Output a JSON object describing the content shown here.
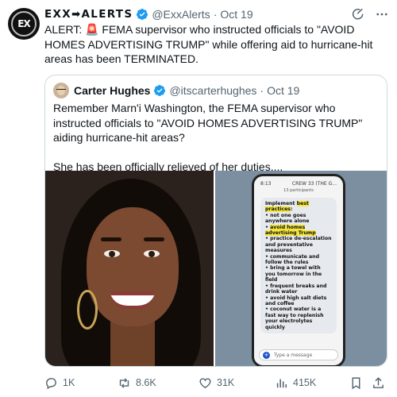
{
  "tweet": {
    "display_name": "EXX➡ALERTS",
    "handle": "@ExxAlerts",
    "separator": "·",
    "date": "Oct 19",
    "text": "ALERT: 🚨 FEMA supervisor who instructed officials to \"AVOID HOMES ADVERTISING TRUMP\" while offering aid to hurricane-hit areas has been TERMINATED.",
    "avatar_icon": "exx-logo",
    "icons": [
      "grok-icon",
      "more-icon"
    ]
  },
  "quote": {
    "display_name": "Carter Hughes",
    "handle": "@itscarterhughes",
    "separator": "·",
    "date": "Oct 19",
    "paragraph_1": "Remember Marn'i Washington, the FEMA supervisor who instructed officials to \"AVOID HOMES ADVERTISING TRUMP\" aiding hurricane-hit areas?",
    "paragraph_2": "She has been officially relieved of her duties....",
    "phone": {
      "time": "8:13",
      "chat_title": "CREW 33 (THE G...",
      "participants": "13 participants",
      "line_1": "Implement",
      "line_1_hl": "best practices",
      "bullets": [
        "not one goes anywhere alone",
        "avoid homes advertising Trump",
        "practice de-escalation and preventative measures",
        "communicate and follow the rules",
        "bring a towel with you tomorrow in the field",
        "frequent breaks and drink water",
        "avoid high salt diets and coffee",
        "coconut water is a fast way to replenish your electrolytes quickly"
      ],
      "input_placeholder": "Type a message"
    }
  },
  "actions": {
    "replies": "1K",
    "reposts": "8.6K",
    "likes": "31K",
    "views": "415K"
  },
  "colors": {
    "verified": "#1d9bf0",
    "secondary_text": "#536471",
    "border": "#cfd9de",
    "highlight": "#f4e63c"
  }
}
